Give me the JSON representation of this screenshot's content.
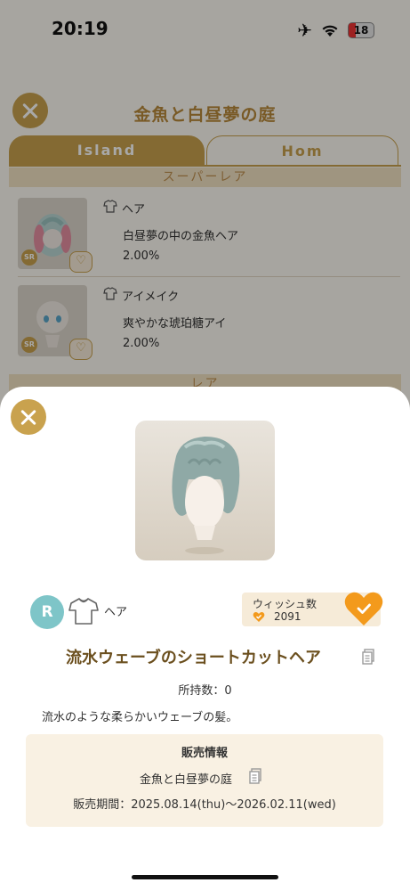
{
  "status_bar": {
    "time": "20:19",
    "battery": "18"
  },
  "background": {
    "title": "金魚と白昼夢の庭",
    "tabs": [
      "Island",
      "Hom"
    ],
    "section_super_rare": "スーパーレア",
    "section_rare": "レア",
    "items": [
      {
        "rarity": "SR",
        "category": "ヘア",
        "name": "白昼夢の中の金魚ヘア",
        "rate": "2.00%"
      },
      {
        "rarity": "SR",
        "category": "アイメイク",
        "name": "爽やかな琥珀糖アイ",
        "rate": "2.00%"
      }
    ]
  },
  "detail": {
    "rarity": "R",
    "category": "ヘア",
    "wishlist_label": "ウィッシュ数",
    "wishlist_count": "2091",
    "item_name": "流水ウェーブのショートカットヘア",
    "owned": "所持数：0",
    "description": "流水のような柔らかいウェーブの髪。",
    "sales": {
      "heading": "販売情報",
      "shop": "金魚と白昼夢の庭",
      "period": "販売期間：2025.08.14(thu)〜2026.02.11(wed)"
    }
  },
  "colors": {
    "gold": "#c9a24e",
    "title_brown": "#6b4f1e",
    "teal": "#7ec5c8",
    "wish_orange": "#f39a1c"
  }
}
